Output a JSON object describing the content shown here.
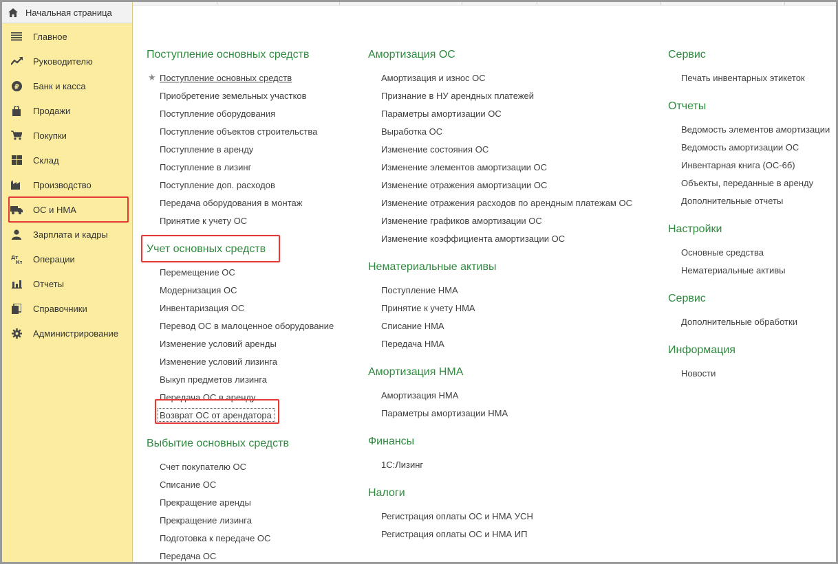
{
  "sidebar": {
    "home_tab": "Начальная страница",
    "items": [
      {
        "label": "Главное",
        "icon": "menu-icon"
      },
      {
        "label": "Руководителю",
        "icon": "trend-icon"
      },
      {
        "label": "Банк и касса",
        "icon": "ruble-icon"
      },
      {
        "label": "Продажи",
        "icon": "bag-icon"
      },
      {
        "label": "Покупки",
        "icon": "cart-icon"
      },
      {
        "label": "Склад",
        "icon": "grid-icon"
      },
      {
        "label": "Производство",
        "icon": "factory-icon"
      },
      {
        "label": "ОС и НМА",
        "icon": "truck-icon"
      },
      {
        "label": "Зарплата и кадры",
        "icon": "person-icon"
      },
      {
        "label": "Операции",
        "icon": "dt-kt-icon"
      },
      {
        "label": "Отчеты",
        "icon": "bar-chart-icon"
      },
      {
        "label": "Справочники",
        "icon": "books-icon"
      },
      {
        "label": "Администрирование",
        "icon": "gear-icon"
      }
    ],
    "selected": "ОС и НМА"
  },
  "col1": {
    "s1_title": "Поступление основных средств",
    "s1_items": [
      "Поступление основных средств",
      "Приобретение земельных участков",
      "Поступление оборудования",
      "Поступление объектов строительства",
      "Поступление в аренду",
      "Поступление в лизинг",
      "Поступление доп. расходов",
      "Передача оборудования в монтаж",
      "Принятие к учету ОС"
    ],
    "s2_title": "Учет основных средств",
    "s2_items": [
      "Перемещение ОС",
      "Модернизация ОС",
      "Инвентаризация ОС",
      "Перевод ОС в малоценное оборудование",
      "Изменение условий аренды",
      "Изменение условий лизинга",
      "Выкуп предметов лизинга",
      "Передача ОС в аренду",
      "Возврат ОС от арендатора"
    ],
    "s3_title": "Выбытие основных средств",
    "s3_items": [
      "Счет покупателю ОС",
      "Списание ОС",
      "Прекращение аренды",
      "Прекращение лизинга",
      "Подготовка к передаче ОС",
      "Передача ОС"
    ]
  },
  "col2": {
    "s1_title": "Амортизация ОС",
    "s1_items": [
      "Амортизация и износ ОС",
      "Признание в НУ арендных платежей",
      "Параметры амортизации ОС",
      "Выработка ОС",
      "Изменение состояния ОС",
      "Изменение элементов амортизации ОС",
      "Изменение отражения амортизации ОС",
      "Изменение отражения расходов по арендным платежам ОС",
      "Изменение графиков амортизации ОС",
      "Изменение коэффициента амортизации ОС"
    ],
    "s2_title": "Нематериальные активы",
    "s2_items": [
      "Поступление НМА",
      "Принятие к учету НМА",
      "Списание НМА",
      "Передача НМА"
    ],
    "s3_title": "Амортизация НМА",
    "s3_items": [
      "Амортизация НМА",
      "Параметры амортизации НМА"
    ],
    "s4_title": "Финансы",
    "s4_items": [
      "1С:Лизинг"
    ],
    "s5_title": "Налоги",
    "s5_items": [
      "Регистрация оплаты ОС и НМА УСН",
      "Регистрация оплаты ОС и НМА ИП"
    ]
  },
  "col3": {
    "s1_title": "Сервис",
    "s1_items": [
      "Печать инвентарных этикеток"
    ],
    "s2_title": "Отчеты",
    "s2_items": [
      "Ведомость элементов амортизации",
      "Ведомость амортизации ОС",
      "Инвентарная книга (ОС-6б)",
      "Объекты, переданные в аренду",
      "Дополнительные отчеты"
    ],
    "s3_title": "Настройки",
    "s3_items": [
      "Основные средства",
      "Нематериальные активы"
    ],
    "s4_title": "Сервис",
    "s4_items": [
      "Дополнительные обработки"
    ],
    "s5_title": "Информация",
    "s5_items": [
      "Новости"
    ]
  },
  "colors": {
    "section_green": "#2e8b3e",
    "sidebar_bg": "#fbec9f",
    "highlight_red": "#e53935"
  }
}
